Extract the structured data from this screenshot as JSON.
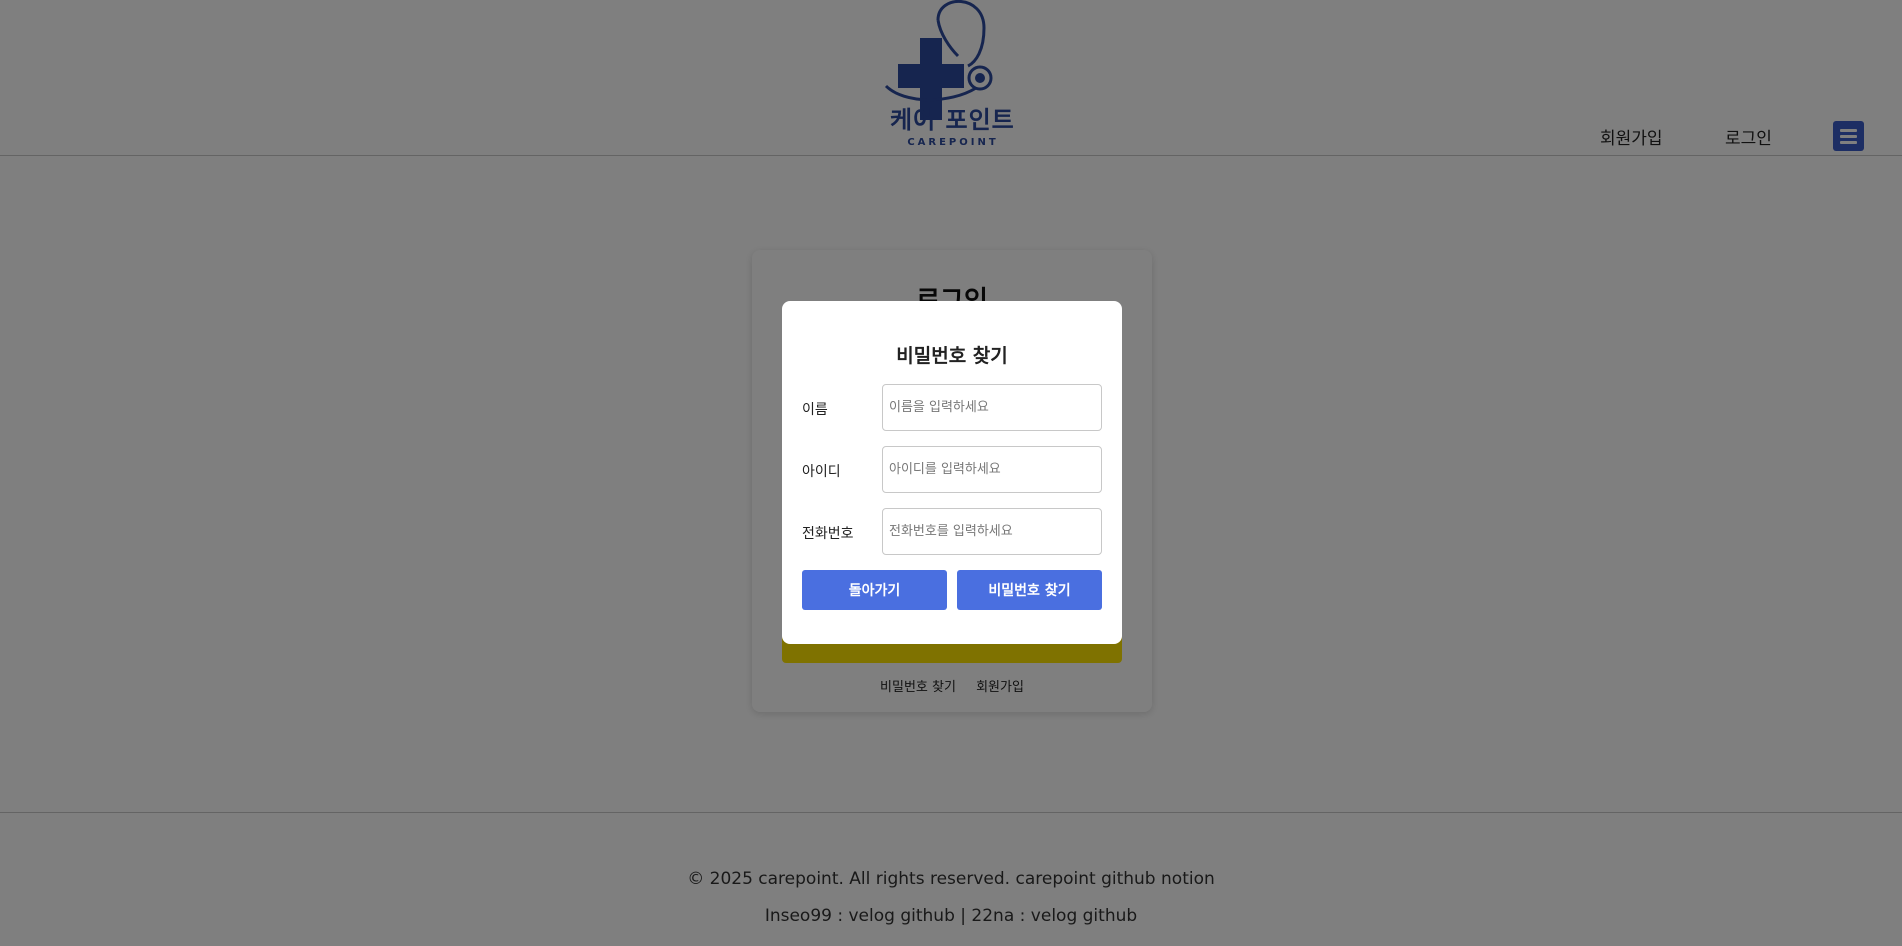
{
  "header": {
    "logo_text": "케어 포인트",
    "logo_sub": "CAREPOINT",
    "nav_signup": "회원가입",
    "nav_login": "로그인",
    "menu_icon": "hamburger-menu-icon",
    "brand_color": "#3b5cc9"
  },
  "login_card": {
    "title": "로그인",
    "find_password_link": "비밀번호 찾기",
    "signup_link": "회원가입"
  },
  "modal": {
    "title": "비밀번호 찾기",
    "fields": [
      {
        "label": "이름",
        "placeholder": "이름을 입력하세요",
        "value": ""
      },
      {
        "label": "아이디",
        "placeholder": "아이디를 입력하세요",
        "value": ""
      },
      {
        "label": "전화번호",
        "placeholder": "전화번호를 입력하세요",
        "value": ""
      }
    ],
    "back_button": "돌아가기",
    "find_button": "비밀번호 찾기",
    "button_color": "#4a6fe0"
  },
  "footer": {
    "copyright_prefix": "© 2025 carepoint. All rights reserved.",
    "link_carepoint_github": "carepoint github",
    "link_notion": "notion",
    "author1": "Inseo99 :",
    "author1_velog": "velog",
    "author1_github": "github",
    "separator": "|",
    "author2": "22na :",
    "author2_velog": "velog",
    "author2_github": "github"
  }
}
